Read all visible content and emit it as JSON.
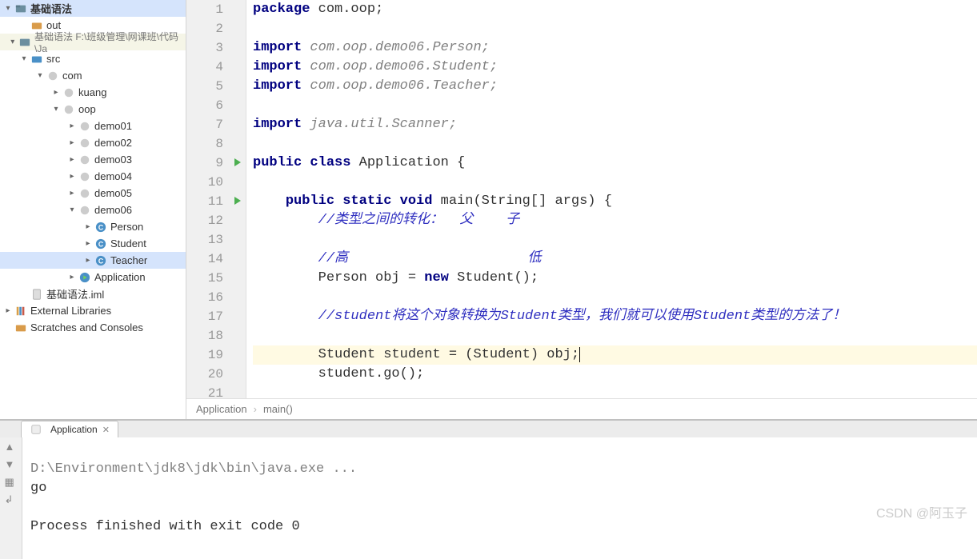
{
  "tree": {
    "root": "基础语法",
    "out": "out",
    "module_path": "基础语法  F:\\班级管理\\网课班\\代码\\Ja",
    "src": "src",
    "com": "com",
    "kuang": "kuang",
    "oop": "oop",
    "demo01": "demo01",
    "demo02": "demo02",
    "demo03": "demo03",
    "demo04": "demo04",
    "demo05": "demo05",
    "demo06": "demo06",
    "person": "Person",
    "student": "Student",
    "teacher": "Teacher",
    "application": "Application",
    "iml": "基础语法.iml",
    "ext_lib": "External Libraries",
    "scratch": "Scratches and Consoles"
  },
  "code": {
    "lines": [
      {
        "n": 1,
        "segments": [
          {
            "t": "package ",
            "c": "kw"
          },
          {
            "t": "com.oop;",
            "c": ""
          }
        ]
      },
      {
        "n": 2,
        "segments": []
      },
      {
        "n": 3,
        "segments": [
          {
            "t": "import ",
            "c": "kw"
          },
          {
            "t": "com.oop.demo06.Person;",
            "c": "comment"
          }
        ]
      },
      {
        "n": 4,
        "segments": [
          {
            "t": "import ",
            "c": "kw"
          },
          {
            "t": "com.oop.demo06.Student;",
            "c": "comment"
          }
        ]
      },
      {
        "n": 5,
        "segments": [
          {
            "t": "import ",
            "c": "kw"
          },
          {
            "t": "com.oop.demo06.Teacher;",
            "c": "comment"
          }
        ]
      },
      {
        "n": 6,
        "segments": []
      },
      {
        "n": 7,
        "segments": [
          {
            "t": "import ",
            "c": "kw"
          },
          {
            "t": "java.util.Scanner;",
            "c": "comment"
          }
        ]
      },
      {
        "n": 8,
        "segments": []
      },
      {
        "n": 9,
        "segments": [
          {
            "t": "public class ",
            "c": "kw"
          },
          {
            "t": "Application {",
            "c": ""
          }
        ],
        "run": true
      },
      {
        "n": 10,
        "segments": []
      },
      {
        "n": 11,
        "segments": [
          {
            "t": "    ",
            "c": ""
          },
          {
            "t": "public static void ",
            "c": "kw"
          },
          {
            "t": "main(String[] args) {",
            "c": ""
          }
        ],
        "run": true
      },
      {
        "n": 12,
        "segments": [
          {
            "t": "        ",
            "c": ""
          },
          {
            "t": "//类型之间的转化：  父    子",
            "c": "comment-cn"
          }
        ]
      },
      {
        "n": 13,
        "segments": []
      },
      {
        "n": 14,
        "segments": [
          {
            "t": "        ",
            "c": ""
          },
          {
            "t": "//高                      低",
            "c": "comment-cn"
          }
        ]
      },
      {
        "n": 15,
        "segments": [
          {
            "t": "        Person obj = ",
            "c": ""
          },
          {
            "t": "new ",
            "c": "kw"
          },
          {
            "t": "Student();",
            "c": ""
          }
        ]
      },
      {
        "n": 16,
        "segments": []
      },
      {
        "n": 17,
        "segments": [
          {
            "t": "        ",
            "c": ""
          },
          {
            "t": "//student将这个对象转换为Student类型，我们就可以使用Student类型的方法了！",
            "c": "comment-cn"
          }
        ]
      },
      {
        "n": 18,
        "segments": []
      },
      {
        "n": 19,
        "segments": [
          {
            "t": "        Student student = (Student) obj;",
            "c": ""
          },
          {
            "t": "",
            "c": "caret"
          }
        ],
        "highlight": true
      },
      {
        "n": 20,
        "segments": [
          {
            "t": "        student.go();",
            "c": ""
          }
        ]
      },
      {
        "n": 21,
        "segments": []
      }
    ]
  },
  "breadcrumb": {
    "class": "Application",
    "method": "main()"
  },
  "run": {
    "tab": "Application",
    "out_line1": "D:\\Environment\\jdk8\\jdk\\bin\\java.exe ...",
    "out_line2": "go",
    "out_line3": "",
    "out_line4": "Process finished with exit code 0"
  },
  "watermark": "CSDN @阿玉子"
}
